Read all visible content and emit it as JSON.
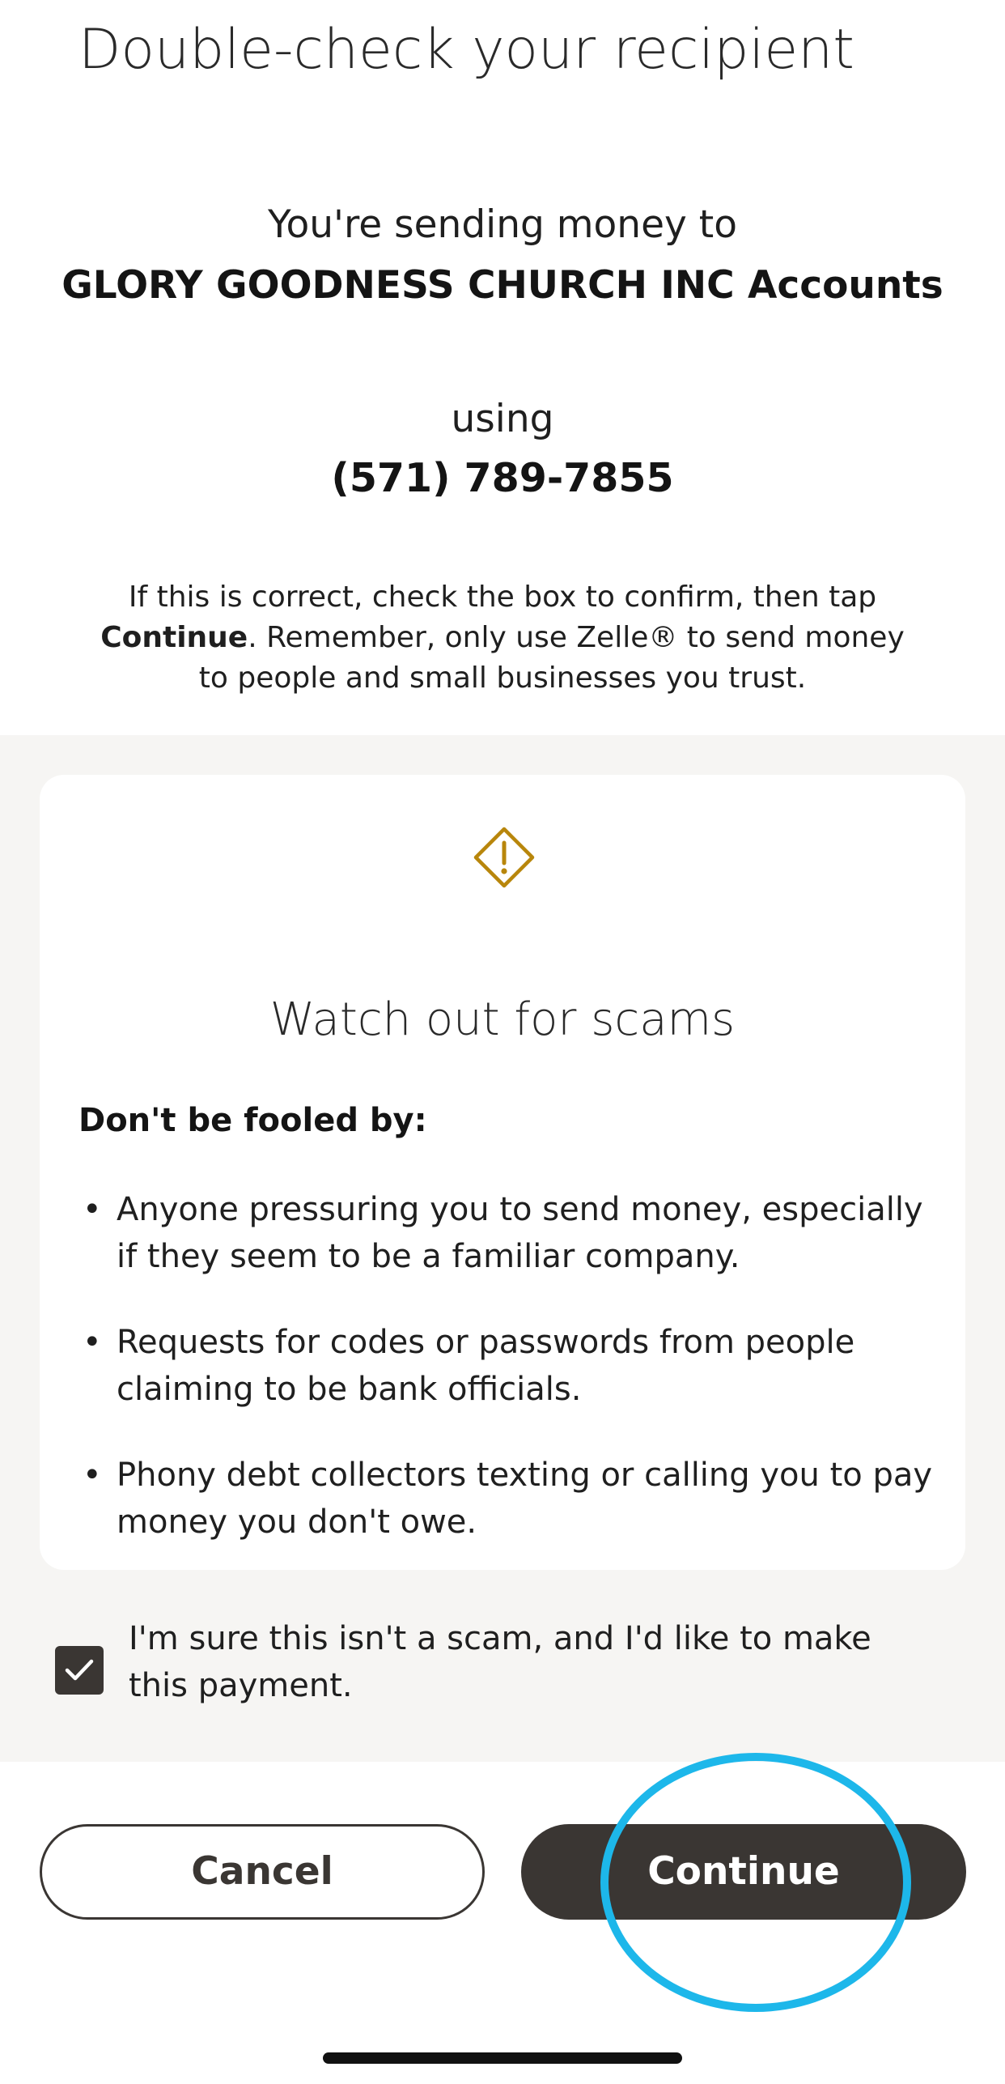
{
  "page": {
    "title": "Double-check your recipient"
  },
  "recipient": {
    "sending_label": "You're sending money to",
    "name": "GLORY GOODNESS CHURCH INC Accounts",
    "using_label": "using",
    "phone": "(571) 789-7855"
  },
  "instructions": {
    "prefix": "If this is correct, check the box to confirm, then tap",
    "bold": "Continue",
    "suffix": ". Remember, only use Zelle® to send money to people and small businesses you trust."
  },
  "warning": {
    "icon": "warning-diamond-icon",
    "title": "Watch out for scams",
    "heading": "Don't be fooled by:",
    "items": [
      {
        "text": "Anyone pressuring you to send money, especially if they seem to be a familiar company."
      },
      {
        "text": "Requests for codes or passwords from people claiming to be bank officials."
      },
      {
        "text": "Phony debt collectors texting or calling you to pay money you don't owe."
      }
    ]
  },
  "confirmation": {
    "checked": true,
    "label": "I'm sure this isn't a scam, and I'd like to make this payment."
  },
  "actions": {
    "cancel_label": "Cancel",
    "continue_label": "Continue"
  },
  "colors": {
    "accent_dark": "#3a3633",
    "warning_gold": "#b8860b",
    "highlight_ring": "#1db7ea",
    "section_bg": "#f6f5f3"
  }
}
